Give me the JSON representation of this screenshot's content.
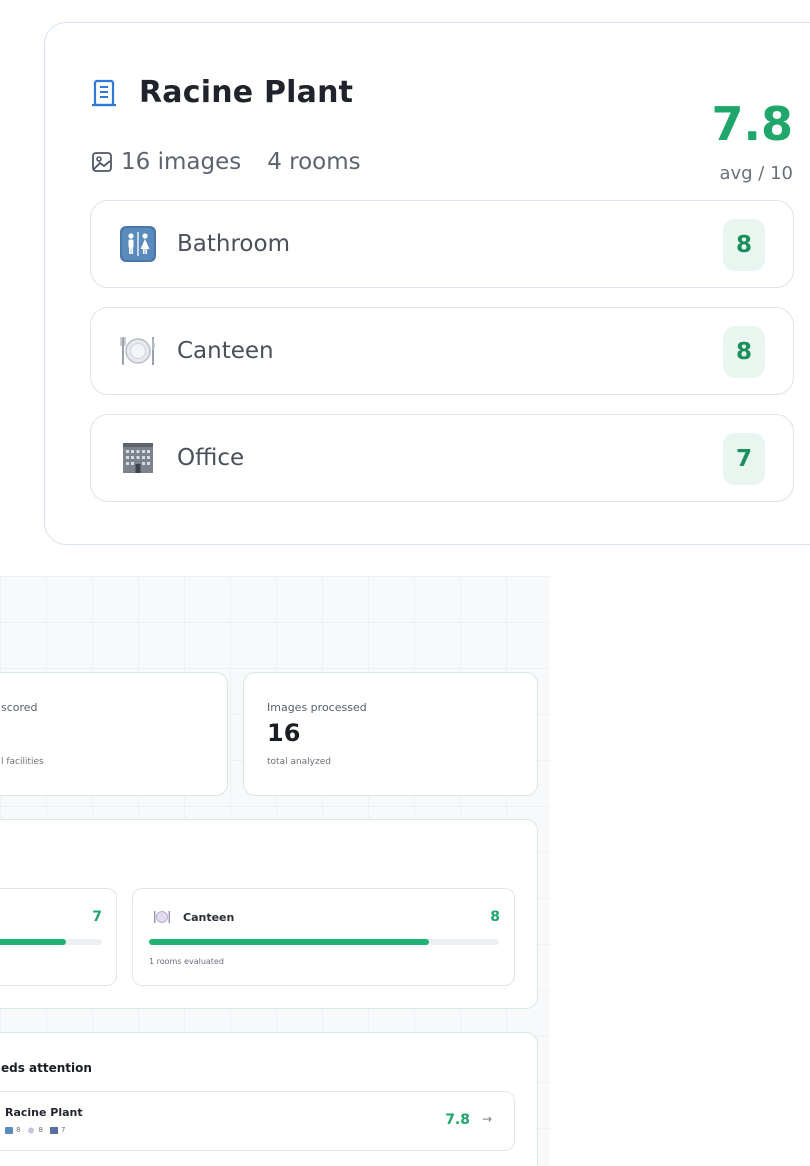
{
  "facility": {
    "name": "Racine Plant",
    "images": "16 images",
    "rooms": "4 rooms",
    "score": "7.8",
    "avg_label": "avg / 10",
    "room_list": [
      {
        "name": "Bathroom",
        "score": "8",
        "icon": "restroom-icon"
      },
      {
        "name": "Canteen",
        "score": "8",
        "icon": "fork-plate-knife-icon"
      },
      {
        "name": "Office",
        "score": "7",
        "icon": "office-building-icon"
      }
    ]
  },
  "dashboard": {
    "stats": [
      {
        "label": "scored",
        "sub": "l facilities"
      },
      {
        "label": "Images processed",
        "value": "16",
        "sub": "total analyzed"
      }
    ],
    "categories": [
      {
        "score": "7",
        "progress": 0.7
      },
      {
        "name": "Canteen",
        "score": "8",
        "progress": 0.8,
        "sub": "1 rooms evaluated"
      }
    ],
    "attention": {
      "title": "eds attention",
      "row": {
        "name": "Racine Plant",
        "mini": [
          "8",
          "8",
          "7"
        ],
        "score": "7.8",
        "arrow": "→"
      }
    }
  },
  "colors": {
    "accent_green": "#1fa66a",
    "score_badge_bg": "#e9f6ef",
    "card_border": "#d6eae3"
  }
}
